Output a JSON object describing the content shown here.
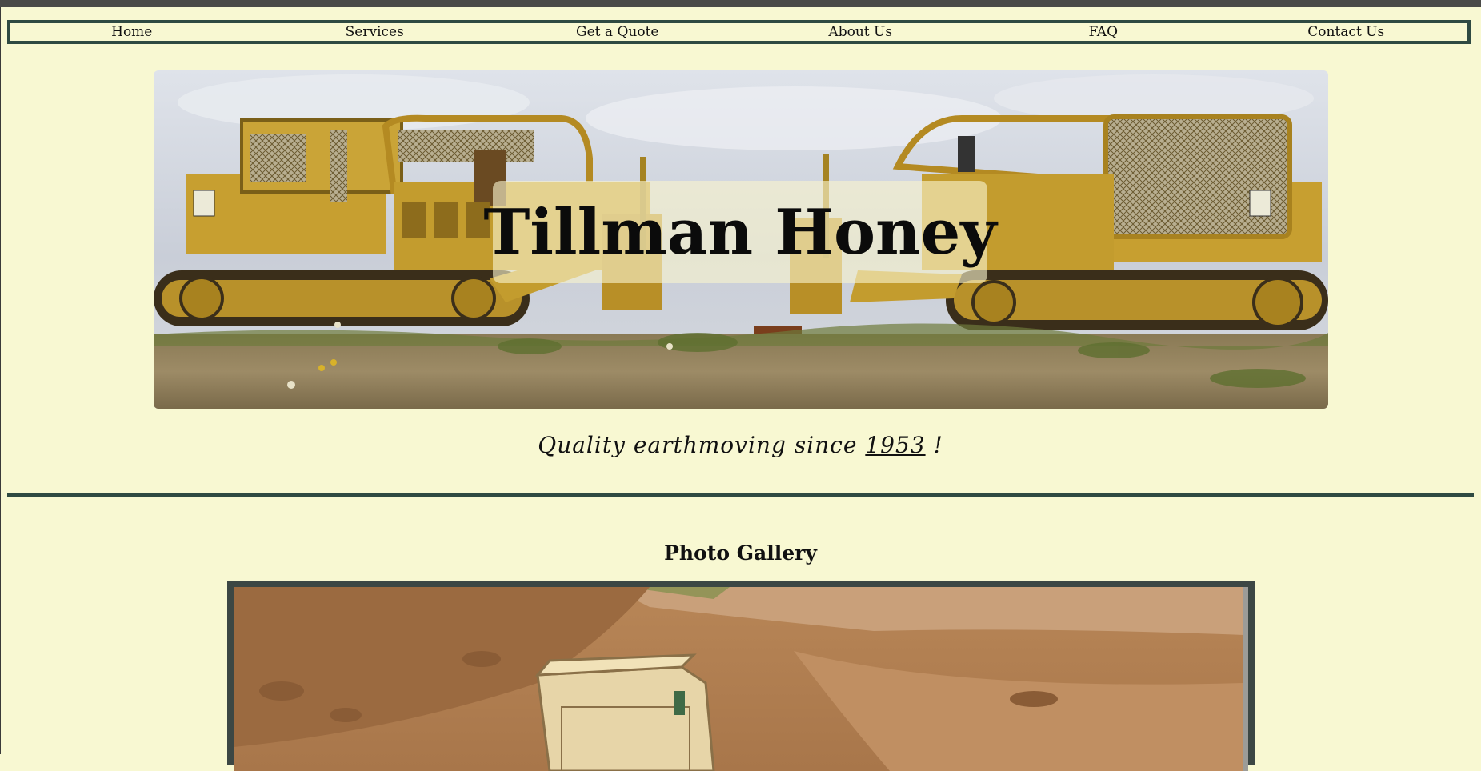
{
  "nav": {
    "items": [
      {
        "label": "Home"
      },
      {
        "label": "Services"
      },
      {
        "label": "Get a Quote"
      },
      {
        "label": "About Us"
      },
      {
        "label": "FAQ"
      },
      {
        "label": "Contact Us"
      }
    ]
  },
  "hero": {
    "title": "Tillman Honey",
    "image_alt": "two-yellow-bulldozers-photo"
  },
  "tagline": {
    "prefix": "Quality earthmoving since",
    "year": "1953",
    "suffix": "!"
  },
  "gallery": {
    "heading": "Photo Gallery",
    "image_alt": "dirt-excavation-photo"
  },
  "colors": {
    "page_bg": "#f8f8d2",
    "accent_border": "#2f4a42",
    "bulldozer_yellow": "#c9a233"
  }
}
